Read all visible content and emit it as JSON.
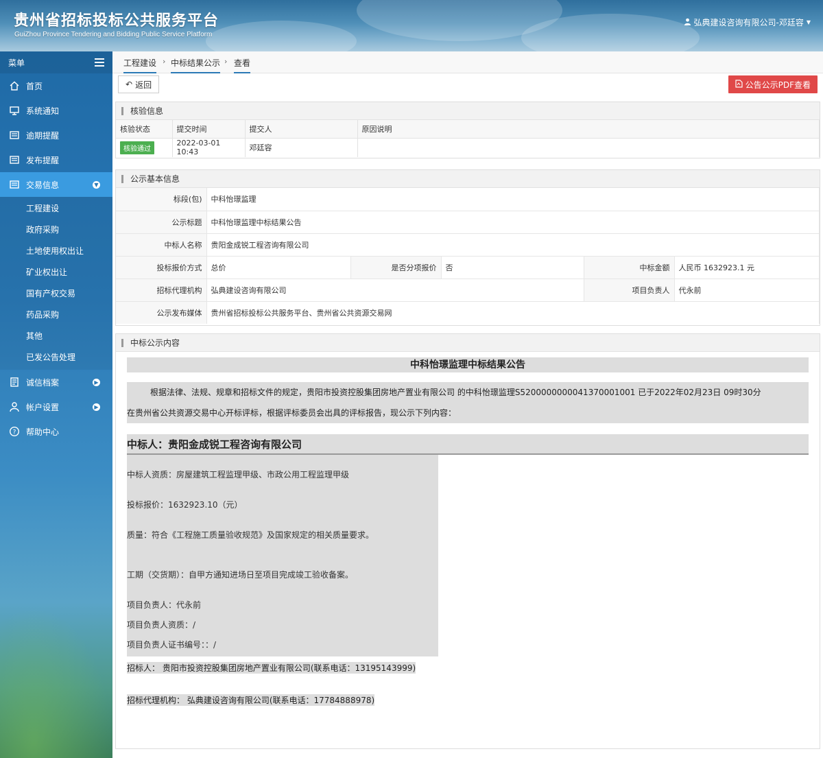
{
  "header": {
    "title": "贵州省招标投标公共服务平台",
    "subtitle": "GuiZhou Province Tendering and Bidding Public Service Platform",
    "user": "弘典建设咨询有限公司-邓廷容"
  },
  "sidebar": {
    "menu_label": "菜单",
    "items": [
      {
        "label": "首页",
        "icon": "home-icon"
      },
      {
        "label": "系统通知",
        "icon": "monitor-icon"
      },
      {
        "label": "逾期提醒",
        "icon": "list-icon"
      },
      {
        "label": "发布提醒",
        "icon": "list-icon"
      },
      {
        "label": "交易信息",
        "icon": "list-icon"
      },
      {
        "label": "诚信档案",
        "icon": "doc-icon"
      },
      {
        "label": "帐户设置",
        "icon": "user-icon"
      },
      {
        "label": "帮助中心",
        "icon": "help-icon"
      }
    ],
    "sub_items": [
      "工程建设",
      "政府采购",
      "土地使用权出让",
      "矿业权出让",
      "国有产权交易",
      "药品采购",
      "其他",
      "已发公告处理"
    ]
  },
  "breadcrumb": [
    "工程建设",
    "中标结果公示",
    "查看"
  ],
  "toolbar": {
    "back": "返回",
    "pdf": "公告公示PDF查看"
  },
  "verify": {
    "title": "核验信息",
    "headers": [
      "核验状态",
      "提交时间",
      "提交人",
      "原因说明"
    ],
    "status": "核验通过",
    "time": "2022-03-01 10:43",
    "person": "邓廷容",
    "reason": ""
  },
  "basic": {
    "title": "公示基本信息",
    "section_label": "标段(包)",
    "section": "中科怡璟监理",
    "notice_title_label": "公示标题",
    "notice_title": "中科怡璟监理中标结果公告",
    "winner_label": "中标人名称",
    "winner": "贵阳金成锐工程咨询有限公司",
    "bid_method_label": "投标报价方式",
    "bid_method": "总价",
    "itemized_label": "是否分项报价",
    "itemized": "否",
    "amount_label": "中标金额",
    "amount": "人民币 1632923.1 元",
    "agency_label": "招标代理机构",
    "agency": "弘典建设咨询有限公司",
    "manager_label": "项目负责人",
    "manager": "代永前",
    "media_label": "公示发布媒体",
    "media": "贵州省招标投标公共服务平台、贵州省公共资源交易网"
  },
  "content": {
    "title": "中标公示内容",
    "heading": "中科怡璟监理中标结果公告",
    "para1": "根据法律、法规、规章和招标文件的规定，贵阳市投资控股集团房地产置业有限公司 的中科怡璟监理S5200000000041370001001 已于2022年02月23日 09时30分",
    "para2": "在贵州省公共资源交易中心开标评标，根据评标委员会出具的评标报告，现公示下列内容：",
    "winner_line": "中标人：贵阳金成锐工程咨询有限公司",
    "qualification": "中标人资质：房屋建筑工程监理甲级、市政公用工程监理甲级",
    "price": "投标报价：1632923.10（元）",
    "quality": "质量：符合《工程施工质量验收规范》及国家规定的相关质量要求。",
    "period": "工期（交货期）：自甲方通知进场日至项目完成竣工验收备案。",
    "pm": "项目负责人：代永前",
    "pm_qual": "项目负责人资质：/",
    "pm_cert": "项目负责人证书编号：：/",
    "tenderer": "招标人： 贵阳市投资控股集团房地产置业有限公司(联系电话：13195143999)",
    "agency_line": "招标代理机构： 弘典建设咨询有限公司(联系电话：17784888978)"
  }
}
